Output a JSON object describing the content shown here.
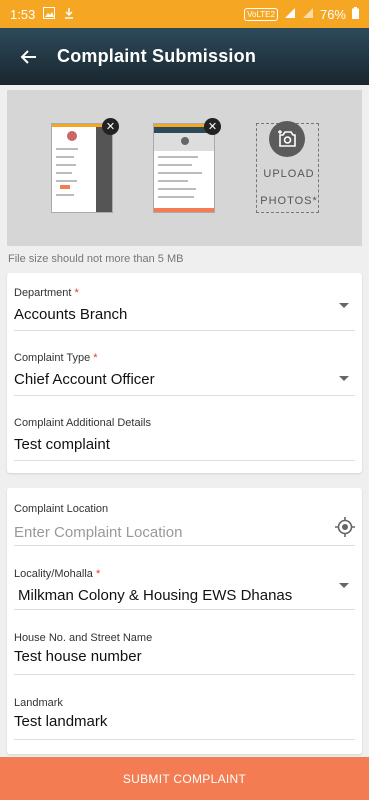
{
  "status_bar": {
    "time": "1:53",
    "volte": "VoLTE2",
    "battery": "76%"
  },
  "app_bar": {
    "title": "Complaint Submission"
  },
  "photos": {
    "upload_line1": "UPLOAD",
    "upload_line2": "PHOTOS*",
    "file_note": "File size should not more than 5 MB"
  },
  "form": {
    "department": {
      "label": "Department",
      "required_mark": "*",
      "value": "Accounts Branch"
    },
    "complaint_type": {
      "label": "Complaint Type",
      "required_mark": "*",
      "value": "Chief Account Officer"
    },
    "additional_details": {
      "label": "Complaint Additional Details",
      "value": "Test complaint"
    },
    "location": {
      "label": "Complaint Location",
      "placeholder": "Enter Complaint Location"
    },
    "locality": {
      "label": "Locality/Mohalla",
      "required_mark": "*",
      "value": "Milkman Colony & Housing EWS Dhanas"
    },
    "house": {
      "label": "House No. and Street Name",
      "value": "Test house number"
    },
    "landmark": {
      "label": "Landmark",
      "value": "Test landmark"
    }
  },
  "submit": {
    "label": "SUBMIT COMPLAINT"
  },
  "colors": {
    "status_bar": "#f5a623",
    "app_bar": "#22353f",
    "submit": "#f47c52",
    "required": "#e53935"
  }
}
